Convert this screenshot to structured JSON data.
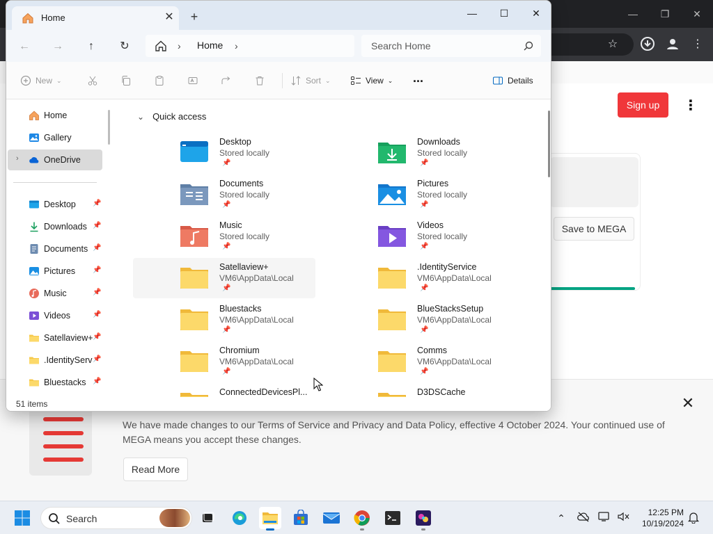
{
  "browser": {
    "signup_label": "Sign up",
    "save_label": "Save to MEGA",
    "banner": {
      "text": "We have made changes to our Terms of Service and Privacy and Data Policy, effective 4 October 2024. Your continued use of MEGA means you accept these changes.",
      "read_more_label": "Read More"
    }
  },
  "explorer": {
    "tab_title": "Home",
    "address": {
      "segments": [
        "Home"
      ]
    },
    "search_placeholder": "Search Home",
    "commands": {
      "new_label": "New",
      "sort_label": "Sort",
      "view_label": "View",
      "more_label": "...",
      "details_label": "Details"
    },
    "nav_pane": {
      "top_items": [
        {
          "label": "Home",
          "icon": "home-icon"
        },
        {
          "label": "Gallery",
          "icon": "gallery-icon"
        },
        {
          "label": "OneDrive",
          "icon": "onedrive-icon",
          "selected": true
        }
      ],
      "pinned_items": [
        {
          "label": "Desktop",
          "icon": "desktop-folder-icon"
        },
        {
          "label": "Downloads",
          "icon": "downloads-folder-icon"
        },
        {
          "label": "Documents",
          "icon": "documents-folder-icon"
        },
        {
          "label": "Pictures",
          "icon": "pictures-folder-icon"
        },
        {
          "label": "Music",
          "icon": "music-folder-icon"
        },
        {
          "label": "Videos",
          "icon": "videos-folder-icon"
        },
        {
          "label": "Satellaview+",
          "icon": "folder-icon"
        },
        {
          "label": ".IdentityServi",
          "icon": "folder-icon"
        },
        {
          "label": "Bluestacks",
          "icon": "folder-icon"
        }
      ]
    },
    "quick_access": {
      "header": "Quick access",
      "items": [
        {
          "name": "Desktop",
          "sub": "Stored locally",
          "icon": "desktop"
        },
        {
          "name": "Downloads",
          "sub": "Stored locally",
          "icon": "downloads"
        },
        {
          "name": "Documents",
          "sub": "Stored locally",
          "icon": "documents"
        },
        {
          "name": "Pictures",
          "sub": "Stored locally",
          "icon": "pictures"
        },
        {
          "name": "Music",
          "sub": "Stored locally",
          "icon": "music"
        },
        {
          "name": "Videos",
          "sub": "Stored locally",
          "icon": "videos"
        },
        {
          "name": "Satellaview+",
          "sub": "VM6\\AppData\\Local",
          "icon": "folder"
        },
        {
          "name": ".IdentityService",
          "sub": "VM6\\AppData\\Local",
          "icon": "folder"
        },
        {
          "name": "Bluestacks",
          "sub": "VM6\\AppData\\Local",
          "icon": "folder"
        },
        {
          "name": "BlueStacksSetup",
          "sub": "VM6\\AppData\\Local",
          "icon": "folder"
        },
        {
          "name": "Chromium",
          "sub": "VM6\\AppData\\Local",
          "icon": "folder"
        },
        {
          "name": "Comms",
          "sub": "VM6\\AppData\\Local",
          "icon": "folder"
        },
        {
          "name": "ConnectedDevicesPl...",
          "sub": "",
          "icon": "folder"
        },
        {
          "name": "D3DSCache",
          "sub": "",
          "icon": "folder"
        }
      ]
    },
    "status": {
      "item_count": "51 items"
    }
  },
  "taskbar": {
    "search_label": "Search",
    "time": "12:25 PM",
    "date": "10/19/2024",
    "colors": {
      "accent": "#0067c0"
    }
  }
}
